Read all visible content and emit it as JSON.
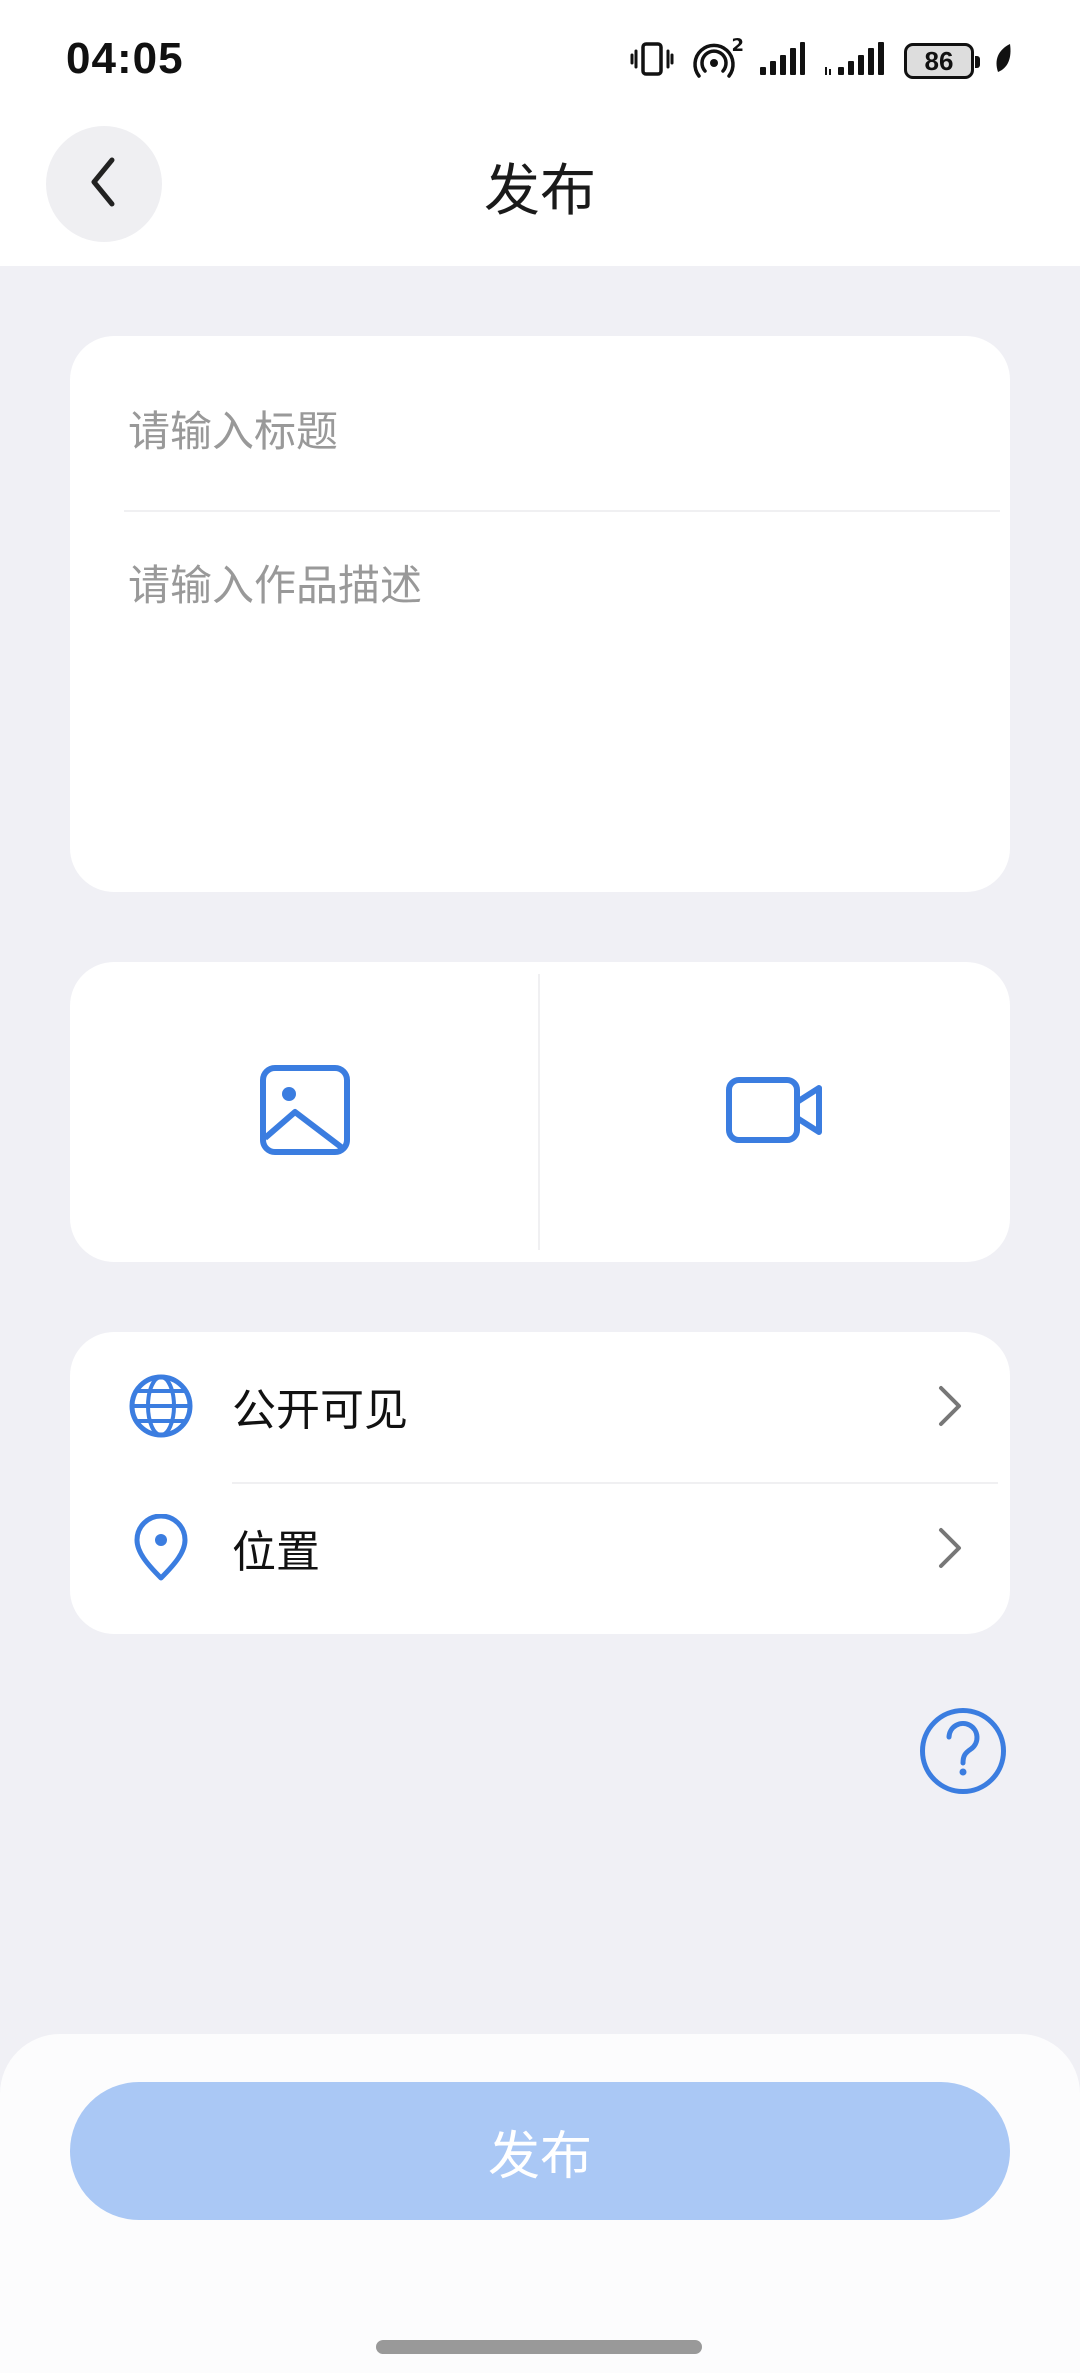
{
  "status_bar": {
    "time": "04:05",
    "battery_level": "86",
    "icons": [
      "vibrate-icon",
      "hotspot-icon",
      "signal-icon",
      "signal-icon-2",
      "battery-icon",
      "leaf-icon"
    ],
    "hotspot_count": "2"
  },
  "header": {
    "title": "发布",
    "back_icon": "chevron-left-icon"
  },
  "text_card": {
    "title_placeholder": "请输入标题",
    "title_value": "",
    "description_placeholder": "请输入作品描述",
    "description_value": ""
  },
  "media_card": {
    "image_icon": "image-icon",
    "video_icon": "video-camera-icon"
  },
  "options": {
    "visibility": {
      "label": "公开可见",
      "icon": "globe-icon"
    },
    "location": {
      "label": "位置",
      "icon": "location-pin-icon"
    }
  },
  "help": {
    "icon": "help-icon",
    "symbol": "?"
  },
  "footer": {
    "publish_label": "发布"
  },
  "colors": {
    "accent": "#3b7de0",
    "publish_disabled": "#aac8f5",
    "background": "#f0f0f5",
    "card": "#ffffff",
    "placeholder": "#999999"
  }
}
